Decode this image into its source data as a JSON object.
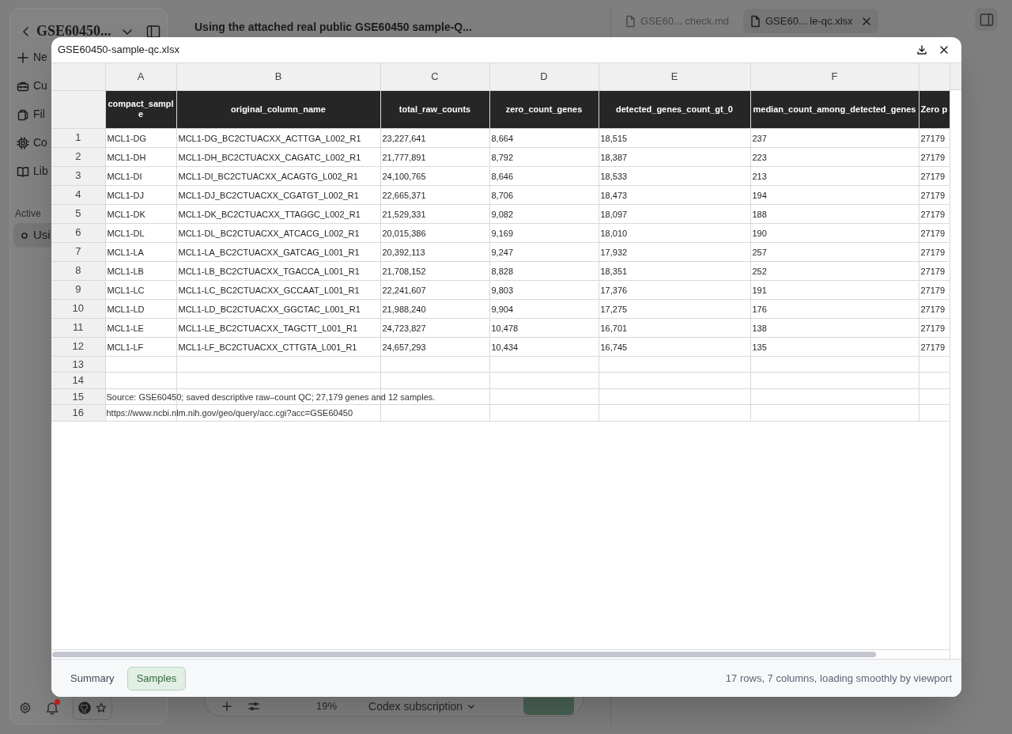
{
  "sidebar": {
    "title": "GSE60450...",
    "nav": [
      {
        "kind": "new",
        "label": "Ne"
      },
      {
        "kind": "toolbox",
        "label": "Cu"
      },
      {
        "kind": "files",
        "label": "Fil"
      },
      {
        "kind": "chip",
        "label": "Co"
      },
      {
        "kind": "book",
        "label": "Lib"
      }
    ],
    "section": "Active",
    "active_items": [
      {
        "label": "Usi",
        "selected": true
      }
    ],
    "notification_unread": true
  },
  "chat": {
    "title": "Using the attached real public GSE60450 sample-Q...",
    "composer": {
      "percent": "19%",
      "model": "Codex subscription"
    }
  },
  "tabs": [
    {
      "label": "GSE60... check.md",
      "selected": false,
      "closable": false
    },
    {
      "label": "GSE60... le-qc.xlsx",
      "selected": true,
      "closable": true
    }
  ],
  "viewer": {
    "title": "GSE60450-sample-qc.xlsx",
    "column_letters": [
      "A",
      "B",
      "C",
      "D",
      "E",
      "F"
    ],
    "header": [
      "compact_sample",
      "original_column_name",
      "total_raw_counts",
      "zero_count_genes",
      "detected_genes_count_gt_0",
      "median_count_among_detected_genes",
      "Zero p"
    ],
    "rows": [
      {
        "number": "1",
        "cells": [
          "MCL1-DG",
          "MCL1-DG_BC2CTUACXX_ACTTGA_L002_R1",
          "23,227,641",
          "8,664",
          "18,515",
          "237",
          "27179"
        ]
      },
      {
        "number": "2",
        "cells": [
          "MCL1-DH",
          "MCL1-DH_BC2CTUACXX_CAGATC_L002_R1",
          "21,777,891",
          "8,792",
          "18,387",
          "223",
          "27179"
        ]
      },
      {
        "number": "3",
        "cells": [
          "MCL1-DI",
          "MCL1-DI_BC2CTUACXX_ACAGTG_L002_R1",
          "24,100,765",
          "8,646",
          "18,533",
          "213",
          "27179"
        ]
      },
      {
        "number": "4",
        "cells": [
          "MCL1-DJ",
          "MCL1-DJ_BC2CTUACXX_CGATGT_L002_R1",
          "22,665,371",
          "8,706",
          "18,473",
          "194",
          "27179"
        ]
      },
      {
        "number": "5",
        "cells": [
          "MCL1-DK",
          "MCL1-DK_BC2CTUACXX_TTAGGC_L002_R1",
          "21,529,331",
          "9,082",
          "18,097",
          "188",
          "27179"
        ]
      },
      {
        "number": "6",
        "cells": [
          "MCL1-DL",
          "MCL1-DL_BC2CTUACXX_ATCACG_L002_R1",
          "20,015,386",
          "9,169",
          "18,010",
          "190",
          "27179"
        ]
      },
      {
        "number": "7",
        "cells": [
          "MCL1-LA",
          "MCL1-LA_BC2CTUACXX_GATCAG_L001_R1",
          "20,392,113",
          "9,247",
          "17,932",
          "257",
          "27179"
        ]
      },
      {
        "number": "8",
        "cells": [
          "MCL1-LB",
          "MCL1-LB_BC2CTUACXX_TGACCA_L001_R1",
          "21,708,152",
          "8,828",
          "18,351",
          "252",
          "27179"
        ]
      },
      {
        "number": "9",
        "cells": [
          "MCL1-LC",
          "MCL1-LC_BC2CTUACXX_GCCAAT_L001_R1",
          "22,241,607",
          "9,803",
          "17,376",
          "191",
          "27179"
        ]
      },
      {
        "number": "10",
        "cells": [
          "MCL1-LD",
          "MCL1-LD_BC2CTUACXX_GGCTAC_L001_R1",
          "21,988,240",
          "9,904",
          "17,275",
          "176",
          "27179"
        ]
      },
      {
        "number": "11",
        "cells": [
          "MCL1-LE",
          "MCL1-LE_BC2CTUACXX_TAGCTT_L001_R1",
          "24,723,827",
          "10,478",
          "16,701",
          "138",
          "27179"
        ]
      },
      {
        "number": "12",
        "cells": [
          "MCL1-LF",
          "MCL1-LF_BC2CTUACXX_CTTGTA_L001_R1",
          "24,657,293",
          "10,434",
          "16,745",
          "135",
          "27179"
        ]
      },
      {
        "number": "13"
      },
      {
        "number": "14"
      },
      {
        "number": "15",
        "note": "Source: GSE60450; saved descriptive raw–count QC; 27,179 genes and 12 samples."
      },
      {
        "number": "16",
        "note": "https://www.ncbi.nlm.nih.gov/geo/query/acc.cgi?acc=GSE60450"
      }
    ],
    "sheets": [
      {
        "label": "Summary",
        "selected": false
      },
      {
        "label": "Samples",
        "selected": true
      }
    ],
    "status": "17 rows, 7 columns, loading smoothly by viewport"
  }
}
